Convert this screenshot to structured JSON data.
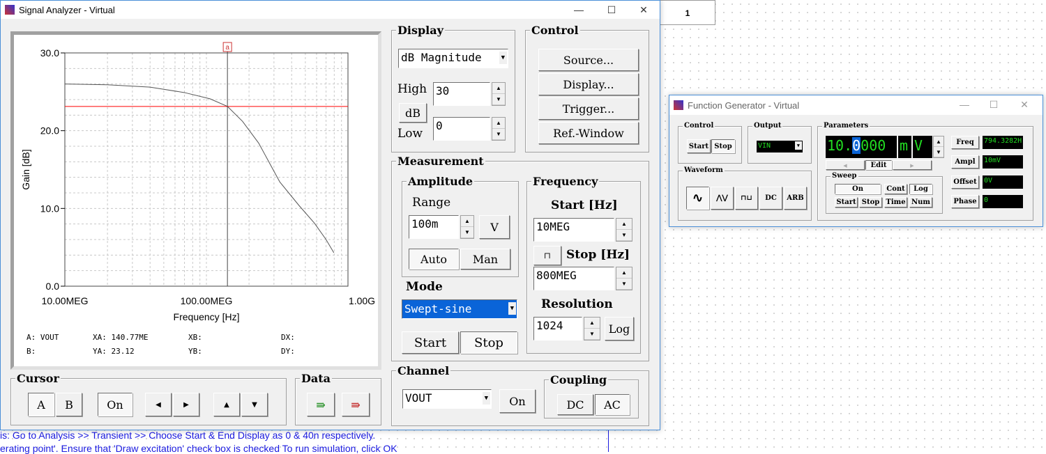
{
  "analyzer": {
    "title": "Signal Analyzer - Virtual",
    "cursor_readout": {
      "a": "A: VOUT",
      "xa": "XA: 140.77ME",
      "xb": "XB:",
      "dx": "DX:",
      "b": "B:",
      "ya": "YA: 23.12",
      "yb": "YB:",
      "dy": "DY:"
    },
    "display": {
      "label": "Display",
      "mode": "dB Magnitude",
      "high_label": "High",
      "high": "30",
      "db_button": "dB",
      "low_label": "Low",
      "low": "0"
    },
    "control": {
      "label": "Control",
      "buttons": [
        "Source...",
        "Display...",
        "Trigger...",
        "Ref.-Window"
      ]
    },
    "measurement": {
      "label": "Measurement",
      "amplitude": {
        "label": "Amplitude",
        "range_label": "Range",
        "range": "100m",
        "unit": "V",
        "auto": "Auto",
        "man": "Man"
      },
      "mode_label": "Mode",
      "mode": "Swept-sine",
      "start": "Start",
      "stop": "Stop",
      "frequency": {
        "label": "Frequency",
        "start_label": "Start [Hz]",
        "start": "10MEG",
        "stop_label": "Stop [Hz]",
        "stop": "800MEG",
        "resolution_label": "Resolution",
        "resolution": "1024",
        "log": "Log",
        "link_icon": "link-icon"
      }
    },
    "channel": {
      "label": "Channel",
      "value": "VOUT",
      "on": "On"
    },
    "coupling": {
      "label": "Coupling",
      "dc": "DC",
      "ac": "AC"
    },
    "cursor": {
      "label": "Cursor",
      "a": "A",
      "b": "B",
      "on": "On"
    },
    "data": {
      "label": "Data"
    }
  },
  "chart_data": {
    "type": "line",
    "xlabel": "Frequency [Hz]",
    "ylabel": "Gain [dB]",
    "xscale": "log",
    "xlim": [
      10000000,
      1000000000
    ],
    "ylim": [
      0,
      30
    ],
    "xticks": [
      "10.00MEG",
      "100.00MEG",
      "1.00G"
    ],
    "yticks": [
      "0.0",
      "10.0",
      "20.0",
      "30.0"
    ],
    "grid": true,
    "series": [
      {
        "x": [
          10000000,
          20000000,
          40000000,
          70000000,
          106000000,
          140770000,
          180000000,
          234000000,
          330000000,
          450000000,
          580000000,
          700000000,
          795000000
        ],
        "y": [
          26.0,
          25.9,
          25.6,
          24.9,
          24.1,
          23.12,
          21.2,
          18.4,
          13.4,
          10.4,
          8.1,
          6.0,
          4.3
        ],
        "color": "#555555"
      }
    ],
    "cursor": {
      "x": 140770000,
      "y": 23.12,
      "label": "a",
      "color": "#ff0000"
    }
  },
  "generator": {
    "title": "Function Generator - Virtual",
    "control": {
      "label": "Control",
      "start": "Start",
      "stop": "Stop"
    },
    "output": {
      "label": "Output",
      "value": "VIN"
    },
    "parameters": {
      "label": "Parameters",
      "value_int": "10.",
      "value_sel": "0",
      "value_rest": "000",
      "prefix": "m",
      "unit": "V",
      "edit": "Edit"
    },
    "waveform": {
      "label": "Waveform",
      "dc": "DC",
      "arb": "ARB"
    },
    "sweep": {
      "label": "Sweep",
      "on": "On",
      "cont": "Cont",
      "log": "Log",
      "start": "Start",
      "stop": "Stop",
      "time": "Time",
      "num": "Num"
    },
    "fields": [
      {
        "label": "Freq",
        "value": "794.3282H"
      },
      {
        "label": "Ampl",
        "value": "10mV"
      },
      {
        "label": "Offset",
        "value": "0V"
      },
      {
        "label": "Phase",
        "value": "0"
      }
    ]
  },
  "background": {
    "cell": "1",
    "line1": "is: Go to Analysis >> Transient >> Choose Start & End Display as 0 & 40n respectively.",
    "line2": "erating point'. Ensure that 'Draw excitation' check box is checked To run simulation, click OK"
  }
}
